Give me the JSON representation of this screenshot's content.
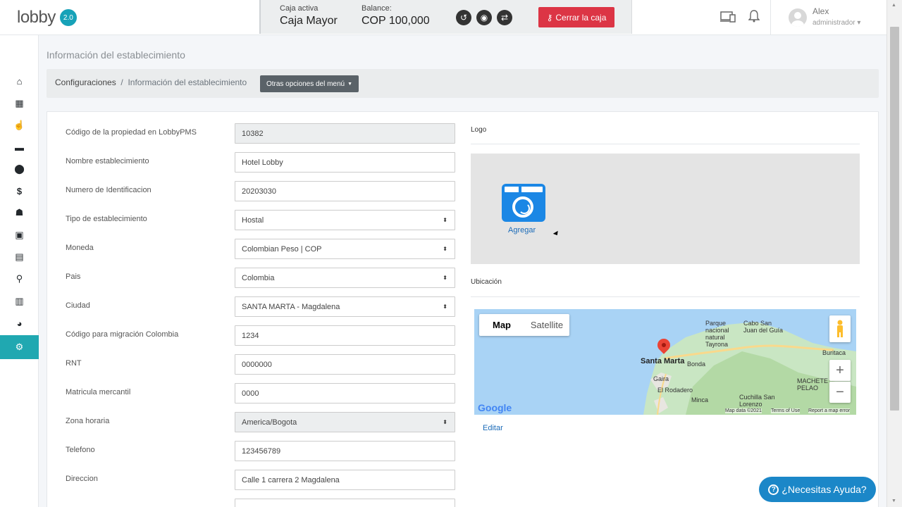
{
  "header": {
    "logo_text": "lobby",
    "logo_version": "2.0",
    "cashbox": {
      "active_label": "Caja activa",
      "active_value": "Caja Mayor",
      "balance_label": "Balance:",
      "balance_value": "COP 100,000",
      "close_button": "Cerrar la caja"
    },
    "user": {
      "name": "Alex",
      "role": "administrador"
    }
  },
  "sidebar": {
    "items": [
      {
        "icon": "home-icon"
      },
      {
        "icon": "calendar-icon"
      },
      {
        "icon": "hand-pointer-icon"
      },
      {
        "icon": "archive-icon"
      },
      {
        "icon": "map-marker-icon"
      },
      {
        "icon": "dollar-icon"
      },
      {
        "icon": "users-icon"
      },
      {
        "icon": "address-book-icon"
      },
      {
        "icon": "clipboard-icon"
      },
      {
        "icon": "search-icon"
      },
      {
        "icon": "bar-chart-icon"
      },
      {
        "icon": "pie-chart-icon"
      },
      {
        "icon": "gear-icon",
        "active": true
      }
    ]
  },
  "page": {
    "title": "Información del establecimiento",
    "breadcrumb": {
      "root": "Configuraciones",
      "separator": "/",
      "current": "Información del establecimiento",
      "menu_button": "Otras opciones del menú"
    }
  },
  "form": {
    "fields": [
      {
        "label": "Código de la propiedad en LobbyPMS",
        "value": "10382",
        "type": "readonly"
      },
      {
        "label": "Nombre establecimiento",
        "value": "Hotel Lobby",
        "type": "text"
      },
      {
        "label": "Numero de Identificacion",
        "value": "20203030",
        "type": "text"
      },
      {
        "label": "Tipo de establecimiento",
        "value": "Hostal",
        "type": "select"
      },
      {
        "label": "Moneda",
        "value": "Colombian Peso | COP",
        "type": "select"
      },
      {
        "label": "Pais",
        "value": "Colombia",
        "type": "select"
      },
      {
        "label": "Ciudad",
        "value": "SANTA MARTA - Magdalena",
        "type": "select"
      },
      {
        "label": "Código para migración Colombia",
        "value": "1234",
        "type": "text"
      },
      {
        "label": "RNT",
        "value": "0000000",
        "type": "text"
      },
      {
        "label": "Matricula mercantil",
        "value": "0000",
        "type": "text"
      },
      {
        "label": "Zona horaria",
        "value": "America/Bogota",
        "type": "select-disabled"
      },
      {
        "label": "Telefono",
        "value": "123456789",
        "type": "text"
      },
      {
        "label": "Direccion",
        "value": "Calle 1 carrera 2 Magdalena",
        "type": "text"
      }
    ]
  },
  "logo_section": {
    "title": "Logo",
    "add_label": "Agregar"
  },
  "location_section": {
    "title": "Ubicación",
    "map": {
      "btn_map": "Map",
      "btn_satellite": "Satellite",
      "city": "Santa Marta",
      "labels": {
        "park": "Parque\nnacional\nnatural\nTayrona",
        "cabo": "Cabo San\nJuan del Guía",
        "buritaca": "Buritaca",
        "bonda": "Bonda",
        "gaira": "Gaira",
        "rodadero": "El Rodadero",
        "minca": "Minca",
        "machete": "MACHETE\nPELAO",
        "cuchilla": "Cuchilla San\nLorenzo"
      },
      "google": "Google",
      "map_data": "Map data ©2021",
      "terms": "Terms of Use",
      "report": "Report a map error"
    },
    "edit_link": "Editar"
  },
  "help_button": "¿Necesitas Ayuda?"
}
